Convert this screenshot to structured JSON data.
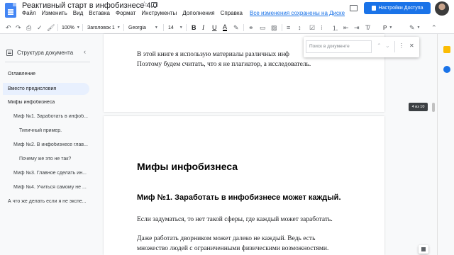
{
  "header": {
    "title": "Реактивный старт в инфобизнесе 4.0",
    "menu": [
      "Файл",
      "Изменить",
      "Вид",
      "Вставка",
      "Формат",
      "Инструменты",
      "Дополнения",
      "Справка"
    ],
    "saved_status": "Все изменения сохранены на Диске",
    "share_label": "Настройки Доступа"
  },
  "toolbar": {
    "zoom": "100%",
    "style": "Заголовок 1",
    "font": "Georgia",
    "font_size": "14",
    "mode_label": "Р",
    "icons": [
      "undo-icon",
      "redo-icon",
      "print-icon",
      "spellcheck-icon",
      "paint-format-icon",
      "bold-icon",
      "italic-icon",
      "underline-icon",
      "text-color-icon",
      "highlight-icon",
      "link-icon",
      "comment-icon",
      "image-icon",
      "align-icon",
      "line-spacing-icon",
      "checklist-icon",
      "bullets-icon",
      "numbering-icon",
      "indent-less-icon",
      "indent-more-icon",
      "clear-format-icon",
      "edit-mode-icon"
    ]
  },
  "outline": {
    "title": "Структура документа",
    "items": [
      {
        "label": "Оглавление",
        "level": 1
      },
      {
        "label": "Вместо предисловия",
        "level": 1,
        "active": true
      },
      {
        "label": "Мифы инфобизнеса",
        "level": 1
      },
      {
        "label": "Миф №1. Заработать в инфоб...",
        "level": 2
      },
      {
        "label": "Типичный пример.",
        "level": 3
      },
      {
        "label": "Миф №2. В инфобизнесе глав...",
        "level": 2
      },
      {
        "label": "Почему же это не так?",
        "level": 3
      },
      {
        "label": "Миф №3. Главное сделать ин...",
        "level": 2
      },
      {
        "label": "Миф №4. Учиться самому не ...",
        "level": 2
      },
      {
        "label": "А что же делать если я не экспе...",
        "level": 1
      }
    ]
  },
  "document": {
    "page1_lines": [
      "В этой книге я использую материалы различных инф",
      "Поэтому будем считать, что я не плагиатор, а исследователь."
    ],
    "heading1": "Мифы инфобизнеса",
    "heading2": "Миф №1. Заработать в инфобизнесе может каждый.",
    "para1": "Если задуматься, то нет такой сферы, где каждый может заработать.",
    "para2_lines": [
      "Даже работать дворником может далеко не каждый. Ведь есть",
      "множество людей с ограниченными физическими возможностями."
    ]
  },
  "find": {
    "placeholder": "Поиск в документе"
  },
  "page_indicator": "4 из 10",
  "colors": {
    "accent": "#1a73e8",
    "doc_blue": "#4285f4",
    "active_outline": "#e8f0fe"
  }
}
